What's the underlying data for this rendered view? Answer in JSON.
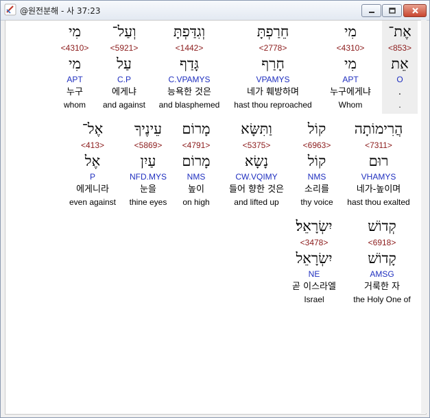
{
  "window": {
    "title": "@원전분해 - 사 37:23"
  },
  "rows": [
    {
      "words": [
        {
          "heb": "מִי",
          "strong": "<4310>",
          "lemma": "מִי",
          "gram": "APT",
          "kor": "누구",
          "eng": "whom"
        },
        {
          "heb": "וְעַל־",
          "strong": "<5921>",
          "lemma": "עַל",
          "gram": "C.P",
          "kor": "에게냐",
          "eng": "and against"
        },
        {
          "heb": "וְגִדַּפְתָּ",
          "strong": "<1442>",
          "lemma": "גָּדַף",
          "gram": "C.VPAMYS",
          "kor": "능욕한 것은",
          "eng": "and blasphemed"
        },
        {
          "heb": "חֵרַפְתָּ",
          "strong": "<2778>",
          "lemma": "חָרַף",
          "gram": "VPAMYS",
          "kor": "네가 훼방하며",
          "eng": "hast thou reproached"
        },
        {
          "heb": "מִי",
          "strong": "<4310>",
          "lemma": "מִי",
          "gram": "APT",
          "kor": "누구에게냐",
          "eng": "Whom"
        },
        {
          "heb": "אֶת־",
          "strong": "<853>",
          "lemma": "אֵת",
          "gram": "O",
          "kor": ".",
          "eng": "."
        }
      ]
    },
    {
      "words": [
        {
          "heb": "אֶל־",
          "strong": "<413>",
          "lemma": "אֶל",
          "gram": "P",
          "kor": "에게니라",
          "eng": "even against"
        },
        {
          "heb": "עֵינֶיךָ",
          "strong": "<5869>",
          "lemma": "עַיִן",
          "gram": "NFD.MYS",
          "kor": "눈을",
          "eng": "thine eyes"
        },
        {
          "heb": "מָרוֹם",
          "strong": "<4791>",
          "lemma": "מָרוֹם",
          "gram": "NMS",
          "kor": "높이",
          "eng": "on high"
        },
        {
          "heb": "וַתִּשָּׂא",
          "strong": "<5375>",
          "lemma": "נָשָׂא",
          "gram": "CW.VQIMY",
          "kor": "들어 향한 것은",
          "eng": "and lifted up"
        },
        {
          "heb": "קוֹל",
          "strong": "<6963>",
          "lemma": "קוֹל",
          "gram": "NMS",
          "kor": "소리를",
          "eng": "thy voice"
        },
        {
          "heb": "הֲרִימוֹתָה",
          "strong": "<7311>",
          "lemma": "רוּם",
          "gram": "VHAMYS",
          "kor": "네가-높이며",
          "eng": "hast thou exalted"
        }
      ]
    },
    {
      "words": [
        {
          "heb": "יִשְׂרָאֵל׃",
          "strong": "<3478>",
          "lemma": "יִשְׂרָאֵל",
          "gram": "NE",
          "kor": "곧 이스라엘",
          "eng": "Israel"
        },
        {
          "heb": "קְדוֹשׁ",
          "strong": "<6918>",
          "lemma": "קָדוֹשׁ",
          "gram": "AMSG",
          "kor": "거룩한 자",
          "eng": "the Holy One of"
        }
      ]
    }
  ],
  "colors": {
    "strong": "#8b1a1a",
    "grammar": "#1f2fbf",
    "highlight": "#eeeeee"
  }
}
